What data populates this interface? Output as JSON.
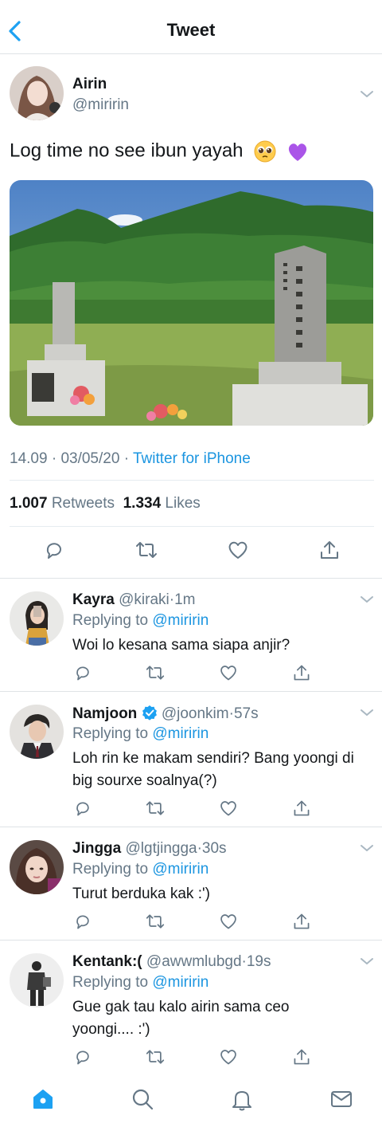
{
  "header": {
    "title": "Tweet"
  },
  "tweet": {
    "name": "Airin",
    "handle": "@miririn",
    "text": "Log time no see ibun yayah",
    "emojis": [
      "pleading-face",
      "purple-heart"
    ],
    "time": "14.09",
    "date": "03/05/20",
    "source": "Twitter for iPhone",
    "sep": "·",
    "retweets": "1.007",
    "retweets_label": "Retweets",
    "likes": "1.334",
    "likes_label": "Likes"
  },
  "replies": [
    {
      "name": "Kayra",
      "handle": "@kiraki",
      "time": "1m",
      "replying_prefix": "Replying to",
      "replying_to": "@miririn",
      "text": "Woi lo kesana sama siapa anjir?"
    },
    {
      "name": "Namjoon",
      "verified": true,
      "handle": "@joonkim",
      "time": "57s",
      "replying_prefix": "Replying to",
      "replying_to": "@miririn",
      "text": "Loh rin ke makam sendiri? Bang yoongi di big sourxe soalnya(?)"
    },
    {
      "name": "Jingga",
      "handle": "@lgtjingga",
      "time": "30s",
      "replying_prefix": "Replying to",
      "replying_to": "@miririn",
      "text": "Turut berduka kak :')"
    },
    {
      "name": "Kentank:(",
      "handle": "@awwmlubgd",
      "time": "19s",
      "replying_prefix": "Replying to",
      "replying_to": "@miririn",
      "text": "Gue gak tau kalo airin sama ceo yoongi.... :')"
    }
  ],
  "icons": [
    "back-icon",
    "chevron-down-icon",
    "reply-icon",
    "retweet-icon",
    "like-icon",
    "share-icon",
    "home-icon",
    "search-icon",
    "notifications-icon",
    "messages-icon"
  ],
  "colors": {
    "accent": "#1da1f2",
    "link": "#1b95e0",
    "secondary_text": "#657786",
    "divider": "#e6ecf0"
  }
}
